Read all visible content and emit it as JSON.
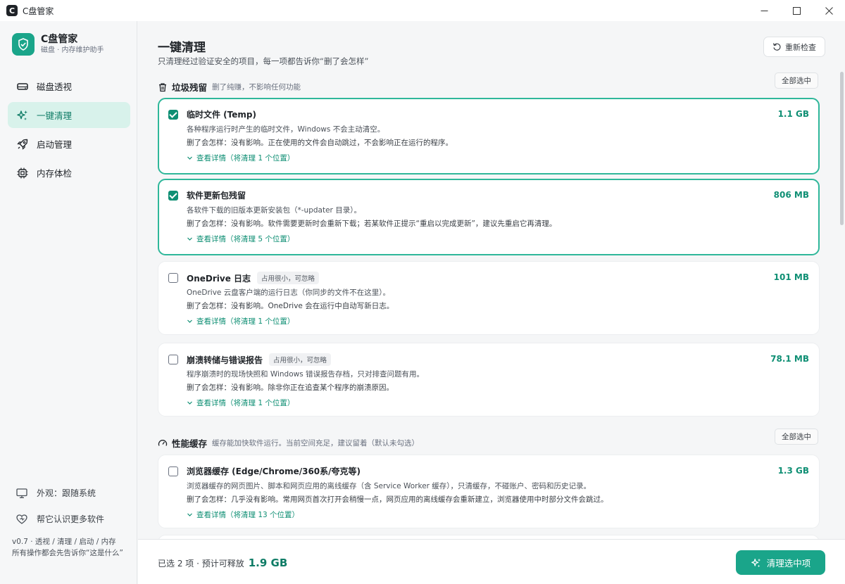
{
  "window": {
    "title": "C盘管家",
    "logo_letter": "C"
  },
  "brand": {
    "name": "C盘管家",
    "subtitle": "磁盘 · 内存维护助手",
    "accent": "#1aa58a"
  },
  "nav": {
    "items": [
      {
        "label": "磁盘透视",
        "icon": "disk-icon",
        "active": false
      },
      {
        "label": "一键清理",
        "icon": "sparkle-icon",
        "active": true
      },
      {
        "label": "启动管理",
        "icon": "rocket-icon",
        "active": false
      },
      {
        "label": "内存体检",
        "icon": "chip-icon",
        "active": false
      }
    ]
  },
  "sidebar_bottom": {
    "appearance": "外观：跟随系统",
    "feedback": "帮它认识更多软件",
    "version_line1": "v0.7 · 透视 / 清理 / 启动 / 内存",
    "version_line2": "所有操作都会先告诉你“这是什么”"
  },
  "page": {
    "title": "一键清理",
    "subtitle": "只清理经过验证安全的项目，每一项都告诉你“删了会怎样”",
    "recheck_label": "重新检查"
  },
  "sections": [
    {
      "title": "垃圾残留",
      "note": "删了纯赚，不影响任何功能",
      "select_all": "全部选中",
      "icon": "trash-icon",
      "items": [
        {
          "name": "临时文件 (Temp)",
          "tag": "",
          "size": "1.1 GB",
          "checked": true,
          "desc": "各种程序运行时产生的临时文件，Windows 不会主动清空。",
          "effect": "删了会怎样：没有影响。正在使用的文件会自动跳过，不会影响正在运行的程序。",
          "details": "查看详情（将清理 1 个位置）"
        },
        {
          "name": "软件更新包残留",
          "tag": "",
          "size": "806 MB",
          "checked": true,
          "desc": "各软件下载的旧版本更新安装包（*-updater 目录）。",
          "effect": "删了会怎样：没有影响。软件需要更新时会重新下载；若某软件正提示“重启以完成更新”，建议先重启它再清理。",
          "details": "查看详情（将清理 5 个位置）"
        },
        {
          "name": "OneDrive 日志",
          "tag": "占用很小，可忽略",
          "size": "101 MB",
          "checked": false,
          "desc": "OneDrive 云盘客户端的运行日志（你同步的文件不在这里）。",
          "effect": "删了会怎样：没有影响。OneDrive 会在运行中自动写新日志。",
          "details": "查看详情（将清理 1 个位置）"
        },
        {
          "name": "崩溃转储与错误报告",
          "tag": "占用很小，可忽略",
          "size": "78.1 MB",
          "checked": false,
          "desc": "程序崩溃时的现场快照和 Windows 错误报告存档，只对排查问题有用。",
          "effect": "删了会怎样：没有影响。除非你正在追查某个程序的崩溃原因。",
          "details": "查看详情（将清理 1 个位置）"
        }
      ]
    },
    {
      "title": "性能缓存",
      "note": "缓存能加快软件运行。当前空间充足，建议留着（默认未勾选）",
      "select_all": "全部选中",
      "icon": "gauge-icon",
      "items": [
        {
          "name": "浏览器缓存 (Edge/Chrome/360系/夸克等)",
          "tag": "",
          "size": "1.3 GB",
          "checked": false,
          "desc": "浏览器缓存的网页图片、脚本和网页应用的离线缓存（含 Service Worker 缓存），只清缓存，不碰账户、密码和历史记录。",
          "effect": "删了会怎样：几乎没有影响。常用网页首次打开会稍慢一点，网页应用的离线缓存会重新建立，浏览器使用中时部分文件会跳过。",
          "details": "查看详情（将清理 13 个位置）"
        }
      ]
    }
  ],
  "footer": {
    "selected_text": "已选 2 项 · 预计可释放",
    "amount": "1.9 GB",
    "clean_label": "清理选中项"
  }
}
